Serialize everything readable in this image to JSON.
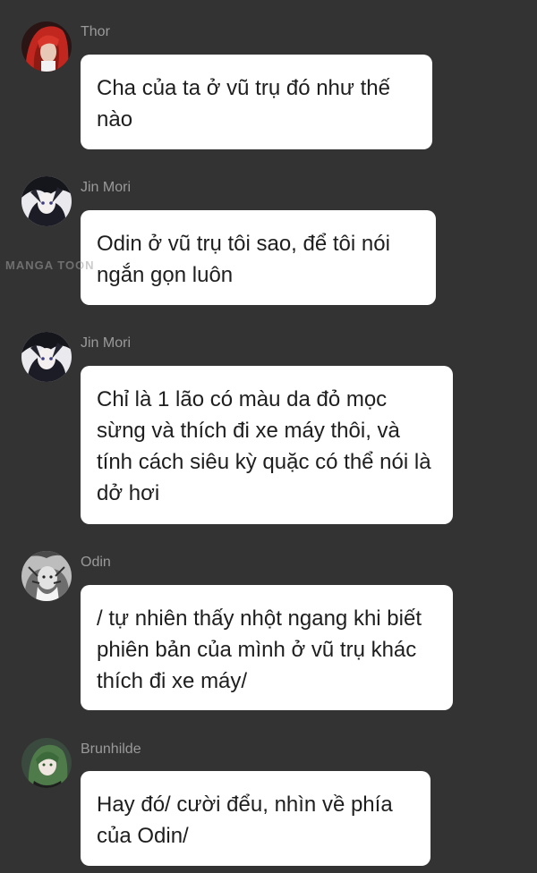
{
  "watermark": "MANGA TOON",
  "messages": [
    {
      "sender": "Thor",
      "avatar_icon": "thor-avatar-icon",
      "text": "Cha của ta ở vũ trụ đó như thế nào"
    },
    {
      "sender": "Jin Mori",
      "avatar_icon": "jin-mori-avatar-icon",
      "text": "Odin ở vũ trụ tôi sao, để tôi nói ngắn gọn luôn"
    },
    {
      "sender": "Jin Mori",
      "avatar_icon": "jin-mori-avatar-icon",
      "text": "Chỉ là 1 lão có màu da đỏ mọc sừng và thích đi xe máy thôi, và tính cách siêu kỳ quặc có thể nói là dở hơi"
    },
    {
      "sender": "Odin",
      "avatar_icon": "odin-avatar-icon",
      "text": "/ tự nhiên thấy nhột ngang khi biết phiên bản của mình ở vũ trụ khác thích đi xe máy/"
    },
    {
      "sender": "Brunhilde",
      "avatar_icon": "brunhilde-avatar-icon",
      "text": "Hay đó/ cười đểu, nhìn về phía của Odin/"
    }
  ]
}
